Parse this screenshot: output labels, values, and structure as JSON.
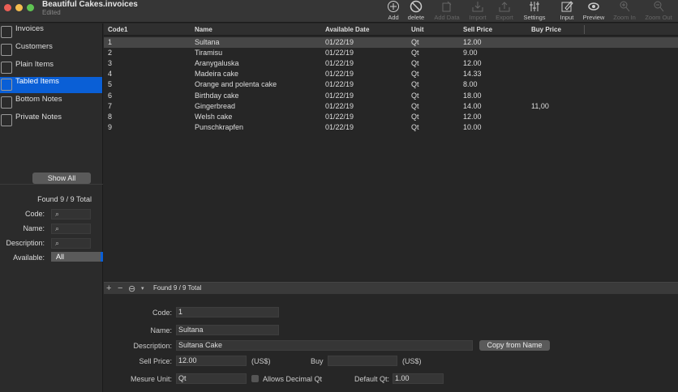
{
  "window": {
    "title": "Beautiful Cakes.invoices",
    "subtitle": "Edited"
  },
  "toolbar": [
    {
      "label": "Add",
      "icon": "plus-circle-icon",
      "enabled": true
    },
    {
      "label": "delete",
      "icon": "prohibit-icon",
      "enabled": true
    },
    {
      "label": "Add Data",
      "icon": "add-data-icon",
      "enabled": false
    },
    {
      "label": "Import",
      "icon": "import-icon",
      "enabled": false
    },
    {
      "label": "Export",
      "icon": "export-icon",
      "enabled": false
    },
    {
      "label": "Settings",
      "icon": "sliders-icon",
      "enabled": true
    },
    {
      "label": "Input",
      "icon": "pencil-icon",
      "enabled": true
    },
    {
      "label": "Preview",
      "icon": "eye-icon",
      "enabled": true
    },
    {
      "label": "Zoom In",
      "icon": "zoom-in-icon",
      "enabled": false
    },
    {
      "label": "Zoom Out",
      "icon": "zoom-out-icon",
      "enabled": false
    }
  ],
  "sidebar": {
    "items": [
      {
        "label": "Invoices"
      },
      {
        "label": "Customers"
      },
      {
        "label": "Plain Items"
      },
      {
        "label": "Tabled Items",
        "selected": true
      },
      {
        "label": "Bottom Notes"
      },
      {
        "label": "Private Notes"
      }
    ],
    "show_all": "Show All",
    "found": "Found 9 / 9 Total",
    "filters": {
      "code": "Code:",
      "name": "Name:",
      "description": "Description:",
      "available": "Available:",
      "available_value": "All"
    }
  },
  "table": {
    "columns": [
      "Code1",
      "Name",
      "Available Date",
      "Unit",
      "Sell Price",
      "Buy Price"
    ],
    "rows": [
      [
        "1",
        "Sultana",
        "01/22/19",
        "Qt",
        "12.00",
        ""
      ],
      [
        "2",
        "Tiramisu",
        "01/22/19",
        "Qt",
        "9.00",
        ""
      ],
      [
        "3",
        "Aranygaluska",
        "01/22/19",
        "Qt",
        "12.00",
        ""
      ],
      [
        "4",
        "Madeira cake",
        "01/22/19",
        "Qt",
        "14.33",
        ""
      ],
      [
        "5",
        "Orange and polenta cake",
        "01/22/19",
        "Qt",
        "8.00",
        ""
      ],
      [
        "6",
        "Birthday cake",
        "01/22/19",
        "Qt",
        "18.00",
        ""
      ],
      [
        "7",
        "Gingerbread",
        "01/22/19",
        "Qt",
        "14.00",
        "11,00"
      ],
      [
        "8",
        "Welsh cake",
        "01/22/19",
        "Qt",
        "12.00",
        ""
      ],
      [
        "9",
        "Punschkrapfen",
        "01/22/19",
        "Qt",
        "10.00",
        ""
      ]
    ],
    "footer": "Found 9 / 9 Total"
  },
  "form": {
    "code_label": "Code:",
    "code": "1",
    "name_label": "Name:",
    "name": "Sultana",
    "description_label": "Description:",
    "description": "Sultana Cake",
    "copy_button": "Copy from Name",
    "sell_label": "Sell Price:",
    "sell": "12.00",
    "currency1": "(US$)",
    "buy_label": "Buy",
    "buy": "",
    "currency2": "(US$)",
    "unit_label": "Mesure Unit:",
    "unit": "Qt",
    "decimal_label": "Allows Decimal Qt",
    "default_label": "Default Qt:",
    "default_qt": "1.00"
  },
  "colors": {
    "accent": "#0a5fd6"
  }
}
